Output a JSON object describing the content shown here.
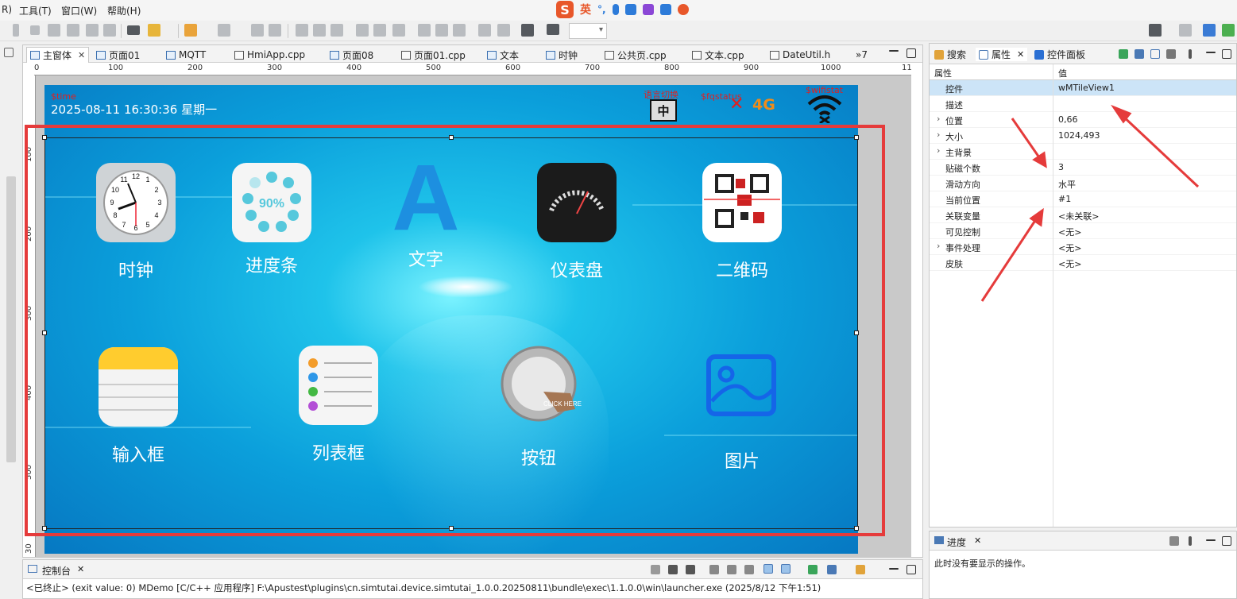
{
  "menu": {
    "items": [
      "R)",
      "工具(T)",
      "窗口(W)",
      "帮助(H)"
    ]
  },
  "ime": {
    "logo": "S",
    "mode": "英",
    "punct": "°,"
  },
  "editor_tabs": [
    {
      "label": "主窗体",
      "closable": true
    },
    {
      "label": "页面01"
    },
    {
      "label": "MQTT"
    },
    {
      "label": "HmiApp.cpp"
    },
    {
      "label": "页面08"
    },
    {
      "label": "页面01.cpp"
    },
    {
      "label": "文本"
    },
    {
      "label": "时钟"
    },
    {
      "label": "公共页.cpp"
    },
    {
      "label": "文本.cpp"
    },
    {
      "label": "DateUtil.h"
    }
  ],
  "tabs_overflow": "»7",
  "ruler": {
    "h_labels": [
      "0",
      "100",
      "200",
      "300",
      "400",
      "500",
      "600",
      "700",
      "800",
      "900",
      "1000",
      "11"
    ],
    "v_labels": [
      "100",
      "200",
      "300",
      "400",
      "500",
      "30"
    ]
  },
  "screen": {
    "datetime": "2025-08-11 16:30:36 星期一",
    "var_time": "$time",
    "var_lang": "语言切换",
    "lang_char": "中",
    "var_fq": "$fqstatus",
    "signal_x": "✕",
    "signal_4g": "4G",
    "var_wifi": "$wifistat",
    "tiles": [
      {
        "label": "时钟",
        "icon": "clock-icon"
      },
      {
        "label": "进度条",
        "icon": "progress-icon",
        "percent": "90%"
      },
      {
        "label": "文字",
        "icon": "text-icon",
        "glyph": "A"
      },
      {
        "label": "仪表盘",
        "icon": "gauge-icon"
      },
      {
        "label": "二维码",
        "icon": "qrcode-icon"
      },
      {
        "label": "输入框",
        "icon": "notepad-icon"
      },
      {
        "label": "列表框",
        "icon": "list-icon"
      },
      {
        "label": "按钮",
        "icon": "click-button-icon",
        "click_text": "CLICK HERE"
      },
      {
        "label": "图片",
        "icon": "picture-icon"
      }
    ],
    "clock_numbers": [
      "12",
      "1",
      "2",
      "3",
      "4",
      "5",
      "6",
      "7",
      "8",
      "9",
      "10",
      "11"
    ]
  },
  "right_panel": {
    "tabs": [
      {
        "label": "搜索",
        "icon": "search-icon"
      },
      {
        "label": "属性",
        "icon": "properties-icon",
        "closable": true
      },
      {
        "label": "控件面板",
        "icon": "cube-icon"
      }
    ],
    "columns": {
      "name": "属性",
      "value": "值"
    },
    "rows": [
      {
        "name": "控件",
        "value": "wMTileView1",
        "selected": true
      },
      {
        "name": "描述",
        "value": ""
      },
      {
        "name": "位置",
        "value": "0,66",
        "expandable": true
      },
      {
        "name": "大小",
        "value": "1024,493",
        "expandable": true
      },
      {
        "name": "主背景",
        "value": "",
        "expandable": true
      },
      {
        "name": "贴磁个数",
        "value": "3"
      },
      {
        "name": "滑动方向",
        "value": "水平"
      },
      {
        "name": "当前位置",
        "value": "#1"
      },
      {
        "name": "关联变量",
        "value": "<未关联>"
      },
      {
        "name": "可见控制",
        "value": "<无>"
      },
      {
        "name": "事件处理",
        "value": "<无>",
        "expandable": true
      },
      {
        "name": "皮肤",
        "value": "<无>"
      }
    ]
  },
  "progress_panel": {
    "title": "进度",
    "message": "此时没有要显示的操作。"
  },
  "console": {
    "title": "控制台",
    "text": "<已终止> (exit value: 0) MDemo [C/C++ 应用程序] F:\\Apustest\\plugins\\cn.simtutai.device.simtutai_1.0.0.20250811\\bundle\\exec\\1.1.0.0\\win\\launcher.exe (2025/8/12 下午1:51)"
  },
  "colors": {
    "selection_red": "#e53b3b",
    "screen_blue": "#0b9fdb",
    "selected_row": "#cce4f7",
    "signal_orange": "#f08c1a"
  }
}
